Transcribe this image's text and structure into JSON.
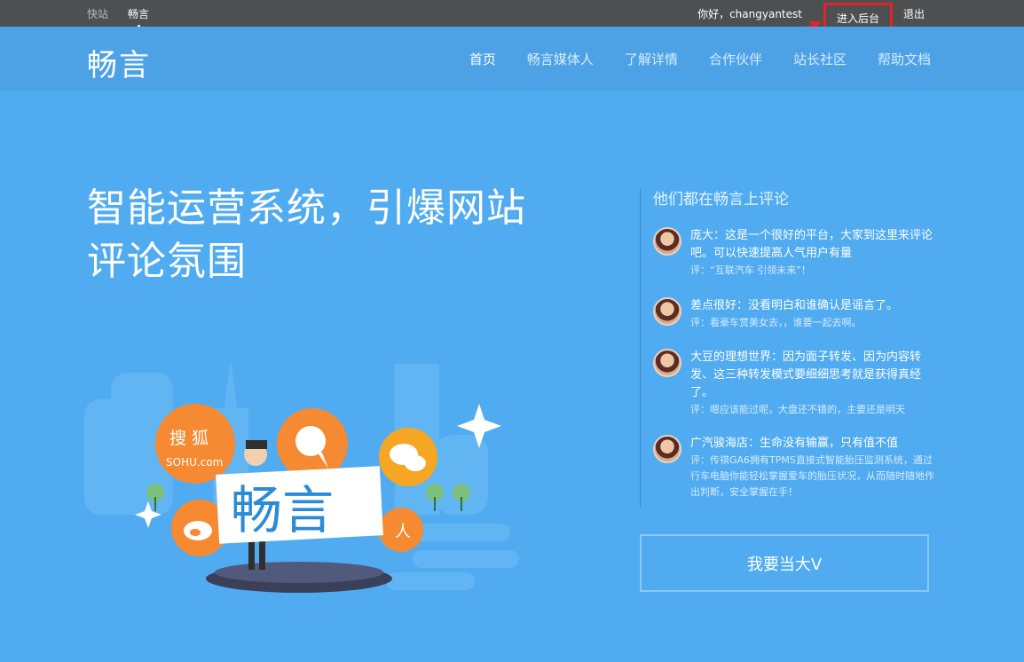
{
  "topbar": {
    "left_items": [
      {
        "label": "快站",
        "active": false
      },
      {
        "label": "畅言",
        "active": true
      }
    ],
    "greeting": "你好，changyantest",
    "admin_link": "进入后台",
    "logout": "退出"
  },
  "navbar": {
    "logo": "畅言",
    "items": [
      {
        "label": "首页",
        "active": true
      },
      {
        "label": "畅言媒体人",
        "active": false
      },
      {
        "label": "了解详情",
        "active": false
      },
      {
        "label": "合作伙伴",
        "active": false
      },
      {
        "label": "站长社区",
        "active": false
      },
      {
        "label": "帮助文档",
        "active": false
      }
    ]
  },
  "hero": {
    "title_line1": "智能运营系统，引爆网站",
    "title_line2": "评论氛围"
  },
  "comments_panel": {
    "title": "他们都在畅言上评论",
    "comments": [
      {
        "text": "庞大：这是一个很好的平台，大家到这里来评论吧。可以快速提高人气用户有量",
        "ref": "评：“互联汽车 引领未来”！"
      },
      {
        "text": "差点很好：没看明白和谁确认是谣言了。",
        "ref": "评：看豪车赏美女去，，谁要一起去啊。"
      },
      {
        "text": "大豆的理想世界：因为面子转发、因为内容转发、这三种转发模式要细细思考就是获得真经了。",
        "ref": "评：嗯应该能过呢，大盘还不错的，主要还是明天"
      },
      {
        "text": "广汽骏海店：生命没有输赢，只有值不值",
        "ref": "评：传祺GA6拥有TPMS直接式智能胎压监测系统，通过行车电脑你能轻松掌握爱车的胎压状况，从而随时随地作出判断，安全掌握在手！"
      }
    ],
    "cta": "我要当大V"
  },
  "illustration": {
    "sign_text": "畅言",
    "sohu_text": "搜 狐",
    "sohu_domain": "SOHU.com"
  },
  "colors": {
    "topbar": "#4d4f51",
    "navbar": "#4da2e6",
    "background": "#50abf1",
    "highlight_box": "#e0242a",
    "orange": "#f58a32",
    "sign_blue": "#2b8bd8"
  }
}
